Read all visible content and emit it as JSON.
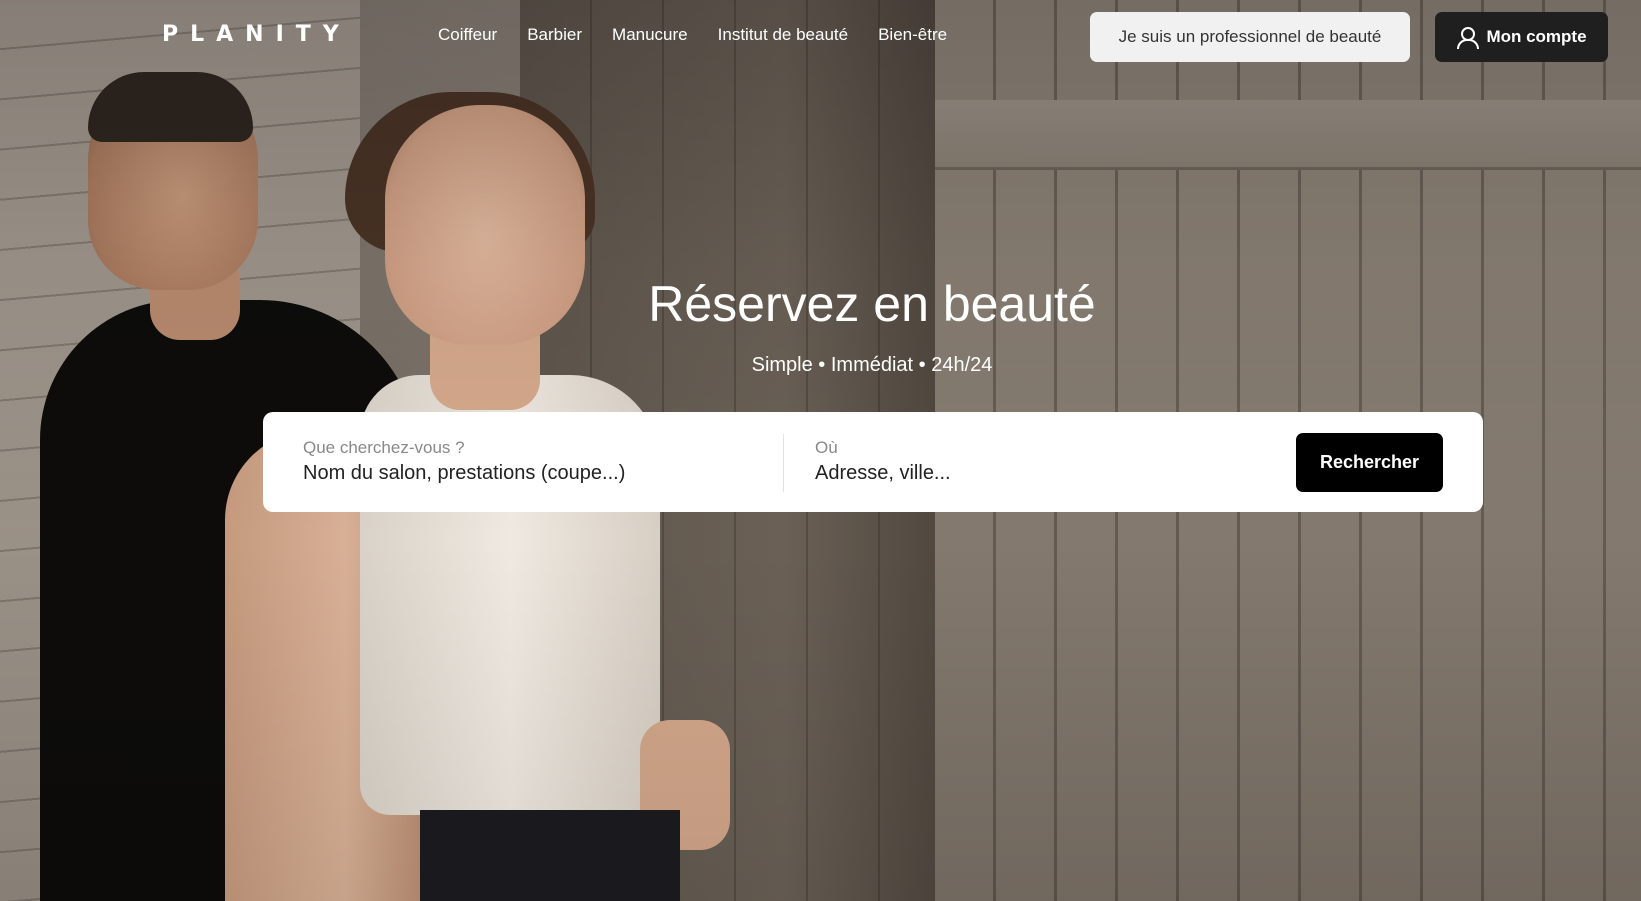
{
  "header": {
    "logo": "PLANITY",
    "nav": [
      {
        "label": "Coiffeur"
      },
      {
        "label": "Barbier"
      },
      {
        "label": "Manucure"
      },
      {
        "label": "Institut de beauté"
      },
      {
        "label": "Bien-être"
      }
    ],
    "pro_button": "Je suis un professionnel de beauté",
    "account_button": "Mon compte"
  },
  "hero": {
    "title": "Réservez en beauté",
    "subtitle": "Simple • Immédiat • 24h/24"
  },
  "search": {
    "what_label": "Que cherchez-vous ?",
    "what_placeholder": "Nom du salon, prestations (coupe...)",
    "where_label": "Où",
    "where_placeholder": "Adresse, ville...",
    "button": "Rechercher"
  },
  "colors": {
    "primary_button": "#000000",
    "account_button": "#1f1f1f",
    "pro_button": "#f1f1f1"
  },
  "icons": {
    "account": "user-icon"
  }
}
